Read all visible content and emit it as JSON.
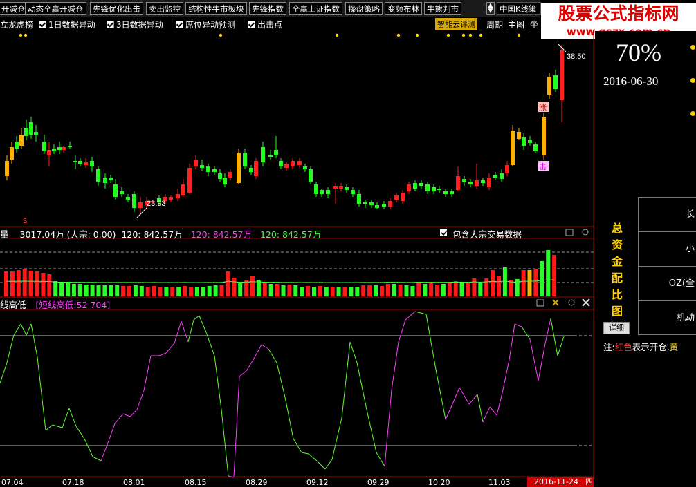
{
  "toolbar": {
    "buttons": [
      "开减仓",
      "动态全赢开减仓",
      "先锋优化出击",
      "卖出监控",
      "结构性牛市板块",
      "先锋指数",
      "全赢上证指数",
      "操盘策略",
      "变频布林",
      "牛熊判市"
    ],
    "scroll_up": "▲",
    "scroll_down": "▼",
    "dropdown_label": "中国K线策"
  },
  "watermark": {
    "title": "股票公式指标网",
    "url": "www.gszx.com.cn"
  },
  "row2": {
    "left_label": "立龙虎榜",
    "checks": [
      "1日数据异动",
      "3日数据异动",
      "席位异动预测",
      "出击点"
    ],
    "zhineng": "智能云评测",
    "cycle": "周期",
    "chart": "主图",
    "coord": "坐"
  },
  "main_chart": {
    "high_label": "38.50",
    "low_label": "23.93",
    "zhang_mark": "涨",
    "chu_mark": "击",
    "small_mark": "S"
  },
  "volume_panel": {
    "title": "量",
    "values": "3017.04万 (大宗: 0.00)",
    "ma1": "120: 842.57万",
    "ma2": "120: 842.57万",
    "ma3": "120: 842.57万",
    "include_label": "包含大宗交易数据"
  },
  "osc_panel": {
    "title": "线高低",
    "value": "[短线高低:52.704]"
  },
  "date_axis": {
    "labels": [
      "07.04",
      "07.18",
      "08.01",
      "08.15",
      "08.29",
      "09.12",
      "09.29",
      "10.20",
      "11.03"
    ],
    "current": "2016-11-24",
    "weekday": "四"
  },
  "right_panel": {
    "percent": "70%",
    "date": "2016-06-30",
    "vertical_title": [
      "总",
      "资",
      "金",
      "配",
      "比",
      "图"
    ],
    "rows": [
      "长",
      "小",
      "OZ(全",
      "机动"
    ],
    "detail_button": "详细",
    "note_prefix": "注:",
    "note_red": "红色",
    "note_white": "表示开仓,",
    "note_yellow": "黄"
  },
  "colors": {
    "up": "#ff2020",
    "down": "#20ff20",
    "yellow": "#ffb000",
    "magenta": "#ff40ff",
    "green_line": "#60ff30"
  }
}
